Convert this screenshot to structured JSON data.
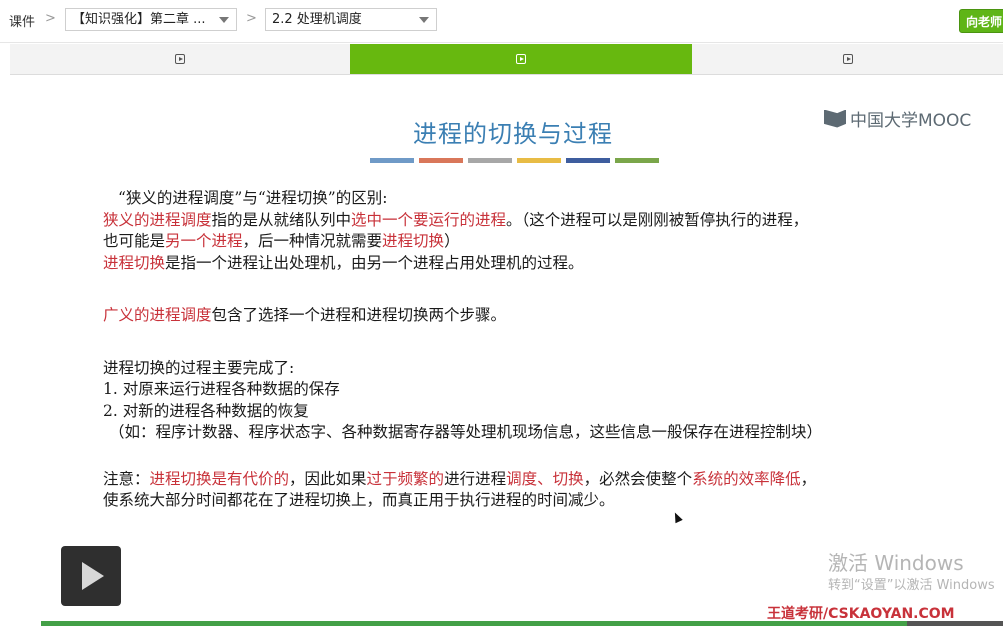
{
  "breadcrumb": {
    "root": "课件",
    "separator": ">",
    "chapter_select": "【知识强化】第二章 ...",
    "section_select": "2.2 处理机调度"
  },
  "ask_teacher_label": "向老师",
  "tabs": [
    {
      "icon": "play-square-icon",
      "active": false
    },
    {
      "icon": "play-square-icon",
      "active": true
    },
    {
      "icon": "play-square-icon",
      "active": false
    }
  ],
  "slide": {
    "title": "进程的切换与过程",
    "logo_text": "中国大学MOOC",
    "bar_colors": [
      "#6f9ac7",
      "#d9775a",
      "#a7a7a7",
      "#e8bc45",
      "#3e5d9e",
      "#7aa64a"
    ],
    "lines": {
      "l1": "“狭义的进程调度”与“进程切换”的区别:",
      "l2a": "狭义的进程调度",
      "l2b": "指的是从就绪队列中",
      "l2c": "选中一个要运行的进程",
      "l2d": "。（这个进程可以是刚刚被暂停执行的进程，",
      "l3a": "也可能是",
      "l3b": "另一个进程",
      "l3c": "，后一种情况就需要",
      "l3d": "进程切换",
      "l3e": "）",
      "l4a": "进程切换",
      "l4b": "是指一个进程让出处理机，由另一个进程占用处理机的过程。",
      "l5a": "广义的进程调度",
      "l5b": "包含了选择一个进程和进程切换两个步骤。",
      "l6": "进程切换的过程主要完成了:",
      "l7": "1.  对原来运行进程各种数据的保存",
      "l8": "2.  对新的进程各种数据的恢复",
      "l9": "（如：程序计数器、程序状态字、各种数据寄存器等处理机现场信息，这些信息一般保存在进程控制块）",
      "l10a": "注意：",
      "l10b": "进程切换是有代价的",
      "l10c": "，因此如果",
      "l10d": "过于频繁的",
      "l10e": "进行进程",
      "l10f": "调度、切换",
      "l10g": "，必然会使整个",
      "l10h": "系统的效率降低",
      "l10i": "，",
      "l11": "使系统大部分时间都花在了进程切换上，而真正用于执行进程的时间减少。"
    }
  },
  "player": {
    "play_icon": "play-icon",
    "progress_fraction": 0.9
  },
  "watermark": {
    "line1": "激活 Windows",
    "line2": "转到“设置”以激活 Windows"
  },
  "brand": "王道考研/CSKAOYAN.COM"
}
